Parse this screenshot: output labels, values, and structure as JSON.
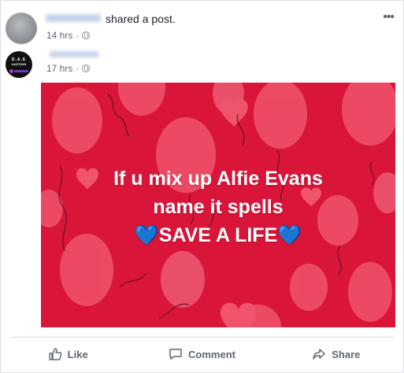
{
  "post": {
    "shared_text": "shared a post.",
    "time": "14 hrs",
    "separator": "·",
    "menu_glyph": "•••"
  },
  "original": {
    "avatar_text_top": "D.A.E",
    "avatar_text_bottom": "AUCTION",
    "time": "17 hrs",
    "separator": "·"
  },
  "image_text": {
    "line1": "If u mix up Alfie Evans",
    "line2": "name it spells",
    "line3_prefix": "💙",
    "line3_main": "SAVE A LIFE",
    "line3_suffix": "💙"
  },
  "actions": {
    "like": "Like",
    "comment": "Comment",
    "share": "Share"
  },
  "icons": [
    "globe-icon",
    "more-options-icon",
    "like-icon",
    "comment-icon",
    "share-icon"
  ],
  "colors": {
    "poster_bg": "#d9163a",
    "balloon": "#f0546c",
    "heart_emoji": "#3b82f6"
  }
}
